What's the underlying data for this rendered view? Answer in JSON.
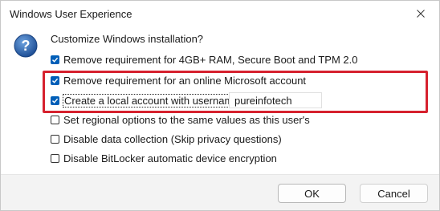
{
  "window": {
    "title": "Windows User Experience"
  },
  "icons": {
    "close": "close-icon",
    "question": "question-icon",
    "check": "check-icon"
  },
  "colors": {
    "accent": "#005fb8",
    "highlight_border": "#d6212e",
    "question_icon": "#2d6bb5"
  },
  "heading": "Customize Windows installation?",
  "options": [
    {
      "label": "Remove requirement for 4GB+ RAM, Secure Boot and TPM 2.0",
      "checked": true
    },
    {
      "label": "Remove requirement for an online Microsoft account",
      "checked": true
    },
    {
      "label": "Create a local account with username",
      "checked": true
    },
    {
      "label": "Set regional options to the same values as this user's",
      "checked": false
    },
    {
      "label": "Disable data collection (Skip privacy questions)",
      "checked": false
    },
    {
      "label": "Disable BitLocker automatic device encryption",
      "checked": false
    }
  ],
  "username": {
    "value": "pureinfotech"
  },
  "buttons": {
    "ok": "OK",
    "cancel": "Cancel"
  }
}
